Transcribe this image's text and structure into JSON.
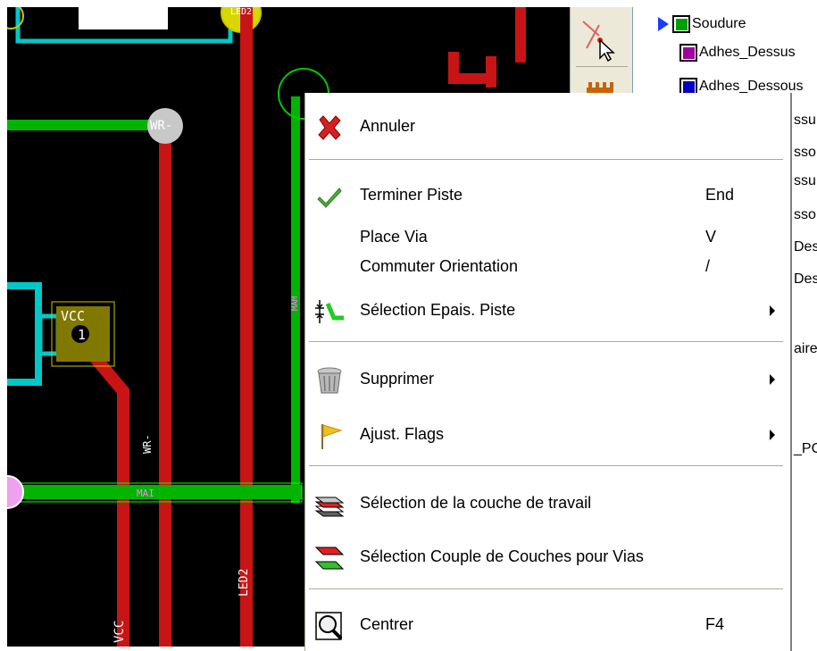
{
  "board": {
    "pad_vcc_name": "VCC",
    "pad_vcc_num": "1",
    "net_wr_pad": "WR-",
    "net_wr_track": "WR-",
    "net_led2_top": "LED2",
    "net_led2_track": "LED2",
    "net_vcc_track": "VCC",
    "net_m_track": "MAI",
    "net_vert": "MAM"
  },
  "layers": {
    "items": [
      {
        "name": "Soudure",
        "color": "#00a000",
        "active": true
      },
      {
        "name": "Adhes_Dessus",
        "color": "#a000a0",
        "active": false
      },
      {
        "name": "Adhes_Dessous",
        "color": "#0000c0",
        "active": false
      }
    ],
    "fragments": [
      "ssu",
      "sso",
      "ssu",
      "sso",
      "Des",
      "Des",
      "aire",
      "_PC"
    ]
  },
  "menu": {
    "items": [
      {
        "label": "Annuler",
        "shortcut": "",
        "submenu": false,
        "icon": "cancel-icon"
      },
      {
        "label": "Terminer Piste",
        "shortcut": "End",
        "submenu": false,
        "icon": "checkmark-icon"
      },
      {
        "label": "Place Via",
        "shortcut": "V",
        "submenu": false,
        "icon": ""
      },
      {
        "label": "Commuter Orientation",
        "shortcut": "/",
        "submenu": false,
        "icon": ""
      },
      {
        "label": "Sélection Epais. Piste",
        "shortcut": "",
        "submenu": true,
        "icon": "track-width-icon"
      },
      {
        "label": "Supprimer",
        "shortcut": "",
        "submenu": true,
        "icon": "trash-icon"
      },
      {
        "label": "Ajust. Flags",
        "shortcut": "",
        "submenu": true,
        "icon": "flag-icon"
      },
      {
        "label": "Sélection de la couche de travail",
        "shortcut": "",
        "submenu": false,
        "icon": "layer-stack-icon"
      },
      {
        "label": "Sélection Couple de Couches pour Vias",
        "shortcut": "",
        "submenu": false,
        "icon": "layer-pair-icon"
      },
      {
        "label": "Centrer",
        "shortcut": "F4",
        "submenu": false,
        "icon": "zoom-center-icon"
      }
    ]
  }
}
